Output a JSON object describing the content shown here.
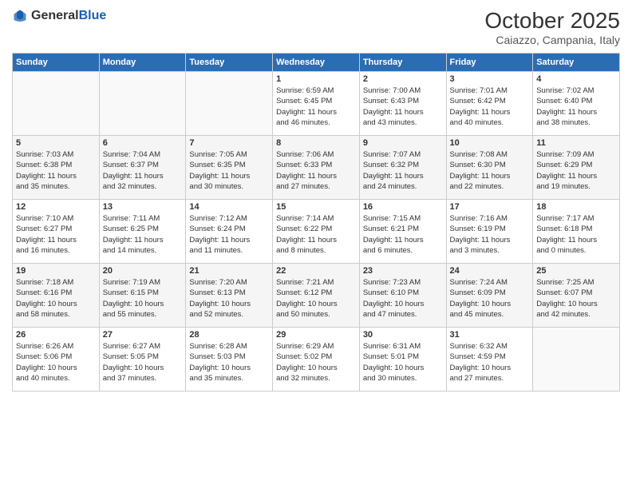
{
  "header": {
    "logo_general": "General",
    "logo_blue": "Blue",
    "title": "October 2025",
    "subtitle": "Caiazzo, Campania, Italy"
  },
  "days_of_week": [
    "Sunday",
    "Monday",
    "Tuesday",
    "Wednesday",
    "Thursday",
    "Friday",
    "Saturday"
  ],
  "weeks": [
    [
      {
        "day": "",
        "info": ""
      },
      {
        "day": "",
        "info": ""
      },
      {
        "day": "",
        "info": ""
      },
      {
        "day": "1",
        "info": "Sunrise: 6:59 AM\nSunset: 6:45 PM\nDaylight: 11 hours\nand 46 minutes."
      },
      {
        "day": "2",
        "info": "Sunrise: 7:00 AM\nSunset: 6:43 PM\nDaylight: 11 hours\nand 43 minutes."
      },
      {
        "day": "3",
        "info": "Sunrise: 7:01 AM\nSunset: 6:42 PM\nDaylight: 11 hours\nand 40 minutes."
      },
      {
        "day": "4",
        "info": "Sunrise: 7:02 AM\nSunset: 6:40 PM\nDaylight: 11 hours\nand 38 minutes."
      }
    ],
    [
      {
        "day": "5",
        "info": "Sunrise: 7:03 AM\nSunset: 6:38 PM\nDaylight: 11 hours\nand 35 minutes."
      },
      {
        "day": "6",
        "info": "Sunrise: 7:04 AM\nSunset: 6:37 PM\nDaylight: 11 hours\nand 32 minutes."
      },
      {
        "day": "7",
        "info": "Sunrise: 7:05 AM\nSunset: 6:35 PM\nDaylight: 11 hours\nand 30 minutes."
      },
      {
        "day": "8",
        "info": "Sunrise: 7:06 AM\nSunset: 6:33 PM\nDaylight: 11 hours\nand 27 minutes."
      },
      {
        "day": "9",
        "info": "Sunrise: 7:07 AM\nSunset: 6:32 PM\nDaylight: 11 hours\nand 24 minutes."
      },
      {
        "day": "10",
        "info": "Sunrise: 7:08 AM\nSunset: 6:30 PM\nDaylight: 11 hours\nand 22 minutes."
      },
      {
        "day": "11",
        "info": "Sunrise: 7:09 AM\nSunset: 6:29 PM\nDaylight: 11 hours\nand 19 minutes."
      }
    ],
    [
      {
        "day": "12",
        "info": "Sunrise: 7:10 AM\nSunset: 6:27 PM\nDaylight: 11 hours\nand 16 minutes."
      },
      {
        "day": "13",
        "info": "Sunrise: 7:11 AM\nSunset: 6:25 PM\nDaylight: 11 hours\nand 14 minutes."
      },
      {
        "day": "14",
        "info": "Sunrise: 7:12 AM\nSunset: 6:24 PM\nDaylight: 11 hours\nand 11 minutes."
      },
      {
        "day": "15",
        "info": "Sunrise: 7:14 AM\nSunset: 6:22 PM\nDaylight: 11 hours\nand 8 minutes."
      },
      {
        "day": "16",
        "info": "Sunrise: 7:15 AM\nSunset: 6:21 PM\nDaylight: 11 hours\nand 6 minutes."
      },
      {
        "day": "17",
        "info": "Sunrise: 7:16 AM\nSunset: 6:19 PM\nDaylight: 11 hours\nand 3 minutes."
      },
      {
        "day": "18",
        "info": "Sunrise: 7:17 AM\nSunset: 6:18 PM\nDaylight: 11 hours\nand 0 minutes."
      }
    ],
    [
      {
        "day": "19",
        "info": "Sunrise: 7:18 AM\nSunset: 6:16 PM\nDaylight: 10 hours\nand 58 minutes."
      },
      {
        "day": "20",
        "info": "Sunrise: 7:19 AM\nSunset: 6:15 PM\nDaylight: 10 hours\nand 55 minutes."
      },
      {
        "day": "21",
        "info": "Sunrise: 7:20 AM\nSunset: 6:13 PM\nDaylight: 10 hours\nand 52 minutes."
      },
      {
        "day": "22",
        "info": "Sunrise: 7:21 AM\nSunset: 6:12 PM\nDaylight: 10 hours\nand 50 minutes."
      },
      {
        "day": "23",
        "info": "Sunrise: 7:23 AM\nSunset: 6:10 PM\nDaylight: 10 hours\nand 47 minutes."
      },
      {
        "day": "24",
        "info": "Sunrise: 7:24 AM\nSunset: 6:09 PM\nDaylight: 10 hours\nand 45 minutes."
      },
      {
        "day": "25",
        "info": "Sunrise: 7:25 AM\nSunset: 6:07 PM\nDaylight: 10 hours\nand 42 minutes."
      }
    ],
    [
      {
        "day": "26",
        "info": "Sunrise: 6:26 AM\nSunset: 5:06 PM\nDaylight: 10 hours\nand 40 minutes."
      },
      {
        "day": "27",
        "info": "Sunrise: 6:27 AM\nSunset: 5:05 PM\nDaylight: 10 hours\nand 37 minutes."
      },
      {
        "day": "28",
        "info": "Sunrise: 6:28 AM\nSunset: 5:03 PM\nDaylight: 10 hours\nand 35 minutes."
      },
      {
        "day": "29",
        "info": "Sunrise: 6:29 AM\nSunset: 5:02 PM\nDaylight: 10 hours\nand 32 minutes."
      },
      {
        "day": "30",
        "info": "Sunrise: 6:31 AM\nSunset: 5:01 PM\nDaylight: 10 hours\nand 30 minutes."
      },
      {
        "day": "31",
        "info": "Sunrise: 6:32 AM\nSunset: 4:59 PM\nDaylight: 10 hours\nand 27 minutes."
      },
      {
        "day": "",
        "info": ""
      }
    ]
  ]
}
